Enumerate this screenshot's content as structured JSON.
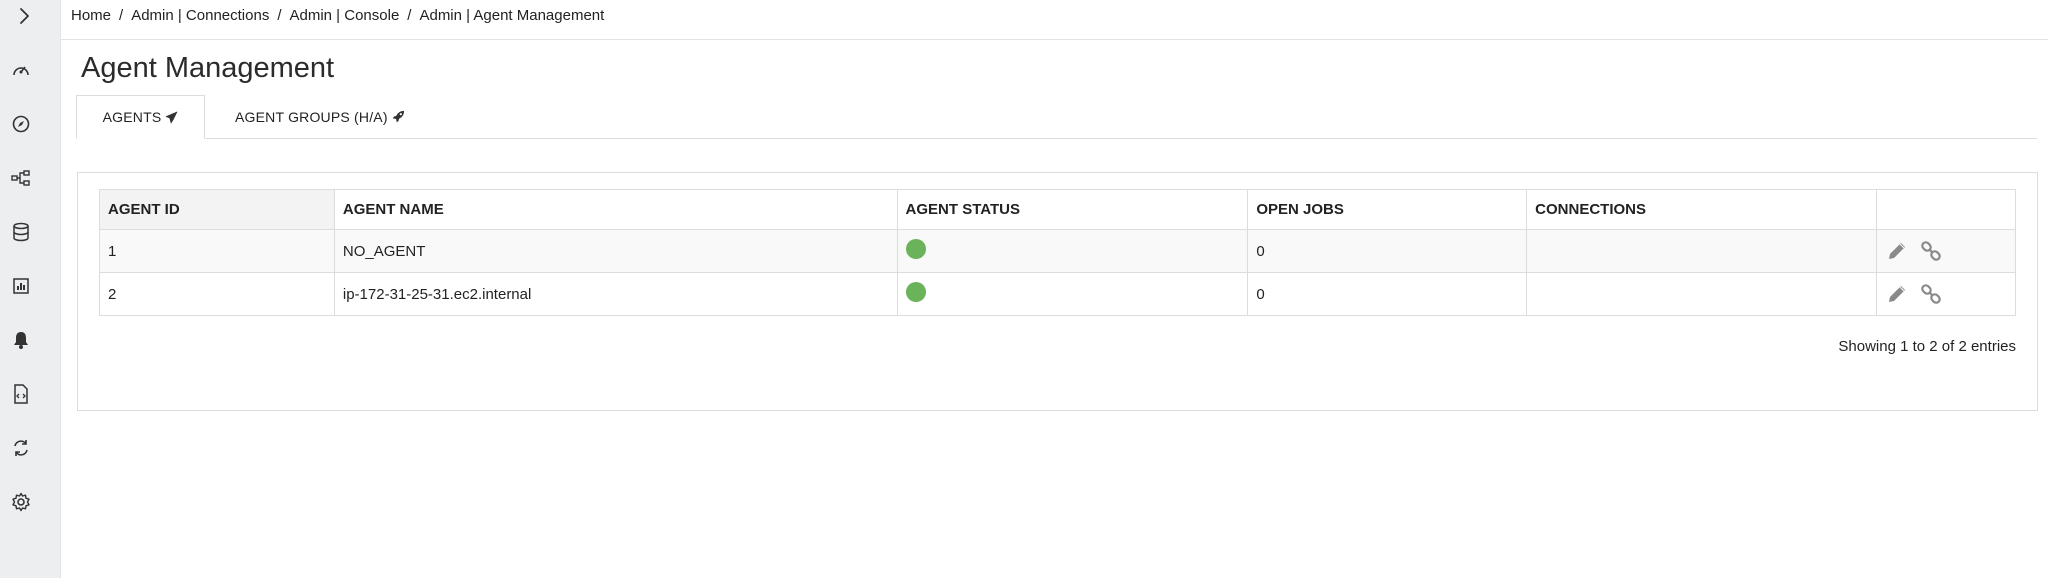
{
  "breadcrumb": [
    {
      "label": "Home"
    },
    {
      "label": "Admin | Connections"
    },
    {
      "label": "Admin | Console"
    },
    {
      "label": "Admin | Agent Management"
    }
  ],
  "breadcrumb_separator": "/",
  "sidebar": {
    "items": [
      {
        "icon": "gauge-icon"
      },
      {
        "icon": "compass-icon"
      },
      {
        "icon": "flow-icon"
      },
      {
        "icon": "database-icon"
      },
      {
        "icon": "report-icon"
      },
      {
        "icon": "bell-icon"
      },
      {
        "icon": "code-file-icon"
      },
      {
        "icon": "sync-icon"
      },
      {
        "icon": "gear-icon"
      }
    ]
  },
  "page": {
    "title": "Agent Management"
  },
  "tabs": [
    {
      "label": "AGENTS",
      "icon": "paper-plane-icon",
      "active": true
    },
    {
      "label": "AGENT GROUPS (H/A)",
      "icon": "rocket-icon",
      "active": false
    }
  ],
  "table": {
    "columns": [
      "AGENT ID",
      "AGENT NAME",
      "AGENT STATUS",
      "OPEN JOBS",
      "CONNECTIONS",
      ""
    ],
    "rows": [
      {
        "id": "1",
        "name": "NO_AGENT",
        "status": "online",
        "open_jobs": "0",
        "connections": ""
      },
      {
        "id": "2",
        "name": "ip-172-31-25-31.ec2.internal",
        "status": "online",
        "open_jobs": "0",
        "connections": ""
      }
    ],
    "info": "Showing 1 to 2 of 2 entries"
  },
  "colors": {
    "status_online": "#6bb35a",
    "sidebar_bg": "#eceeef"
  }
}
